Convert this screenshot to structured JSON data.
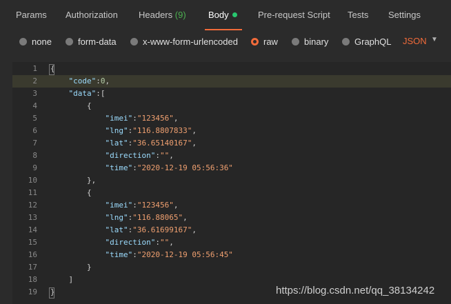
{
  "tabs": [
    {
      "label": "Params"
    },
    {
      "label": "Authorization"
    },
    {
      "label": "Headers",
      "count": "(9)"
    },
    {
      "label": "Body"
    },
    {
      "label": "Pre-request Script"
    },
    {
      "label": "Tests"
    },
    {
      "label": "Settings"
    }
  ],
  "active_tab": "Body",
  "body_options": [
    {
      "label": "none",
      "checked": false
    },
    {
      "label": "form-data",
      "checked": false
    },
    {
      "label": "x-www-form-urlencoded",
      "checked": false
    },
    {
      "label": "raw",
      "checked": true
    },
    {
      "label": "binary",
      "checked": false
    },
    {
      "label": "GraphQL",
      "checked": false
    }
  ],
  "raw_format": "JSON",
  "lines": [
    {
      "num": "1",
      "text": "{"
    },
    {
      "num": "2",
      "text": "    \"code\":0,"
    },
    {
      "num": "3",
      "text": "    \"data\":["
    },
    {
      "num": "4",
      "text": "        {"
    },
    {
      "num": "5",
      "text": "            \"imei\":\"123456\","
    },
    {
      "num": "6",
      "text": "            \"lng\":\"116.8807833\","
    },
    {
      "num": "7",
      "text": "            \"lat\":\"36.65140167\","
    },
    {
      "num": "8",
      "text": "            \"direction\":\"\","
    },
    {
      "num": "9",
      "text": "            \"time\":\"2020-12-19 05:56:36\""
    },
    {
      "num": "10",
      "text": "        },"
    },
    {
      "num": "11",
      "text": "        {"
    },
    {
      "num": "12",
      "text": "            \"imei\":\"123456\","
    },
    {
      "num": "13",
      "text": "            \"lng\":\"116.88065\","
    },
    {
      "num": "14",
      "text": "            \"lat\":\"36.61699167\","
    },
    {
      "num": "15",
      "text": "            \"direction\":\"\","
    },
    {
      "num": "16",
      "text": "            \"time\":\"2020-12-19 05:56:45\""
    },
    {
      "num": "17",
      "text": "        }"
    },
    {
      "num": "18",
      "text": "    ]"
    },
    {
      "num": "19",
      "text": "}"
    }
  ],
  "highlighted_line": "2",
  "watermark": "https://blog.csdn.net/qq_38134242",
  "colors": {
    "accent": "#f26b3a",
    "body_dot": "#28c76f",
    "headers_count": "#4caf50"
  }
}
